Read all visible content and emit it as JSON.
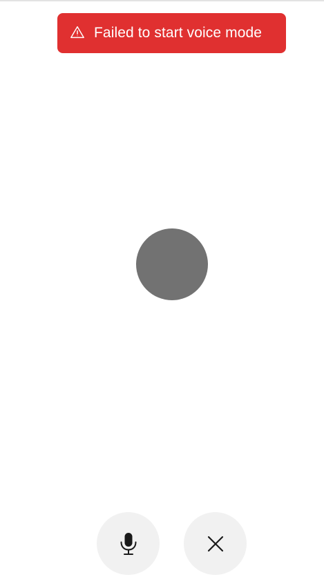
{
  "toast": {
    "icon": "warning-triangle-icon",
    "message": "Failed to start voice mode",
    "background_color": "#e03030",
    "text_color": "#ffffff"
  },
  "voice_orb": {
    "color": "#727272"
  },
  "controls": {
    "mic_icon": "microphone-icon",
    "close_icon": "close-icon",
    "button_background": "#f1f1f1",
    "icon_color": "#1a1a1a"
  }
}
